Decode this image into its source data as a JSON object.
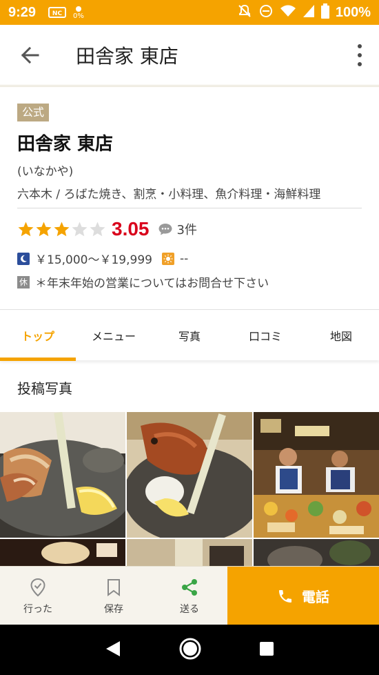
{
  "status_bar": {
    "time": "9:29",
    "battery": "100%",
    "small_pct": "0%"
  },
  "app_bar": {
    "title": "田舎家 東店"
  },
  "restaurant": {
    "badge": "公式",
    "name": "田舎家 東店",
    "kana": "(いなかや)",
    "area_genre": "六本木 / ろばた焼き、割烹・小料理、魚介料理・海鮮料理",
    "rating": "3.05",
    "rating_value": 3.05,
    "review_count": "3件",
    "dinner_price": "￥15,000～￥19,999",
    "lunch_price": "--",
    "holiday_icon": "休",
    "holiday_note": "＊年末年始の営業についてはお問合せ下さい"
  },
  "tabs": [
    {
      "label": "トップ",
      "active": true
    },
    {
      "label": "メニュー",
      "active": false
    },
    {
      "label": "写真",
      "active": false
    },
    {
      "label": "口コミ",
      "active": false
    },
    {
      "label": "地図",
      "active": false
    }
  ],
  "photos": {
    "section_title": "投稿写真"
  },
  "actions": {
    "went_label": "行った",
    "save_label": "保存",
    "share_label": "送る",
    "call_label": "電話"
  },
  "colors": {
    "brand_orange": "#f5a300",
    "score_red": "#d9001b",
    "badge_tan": "#bca983"
  }
}
